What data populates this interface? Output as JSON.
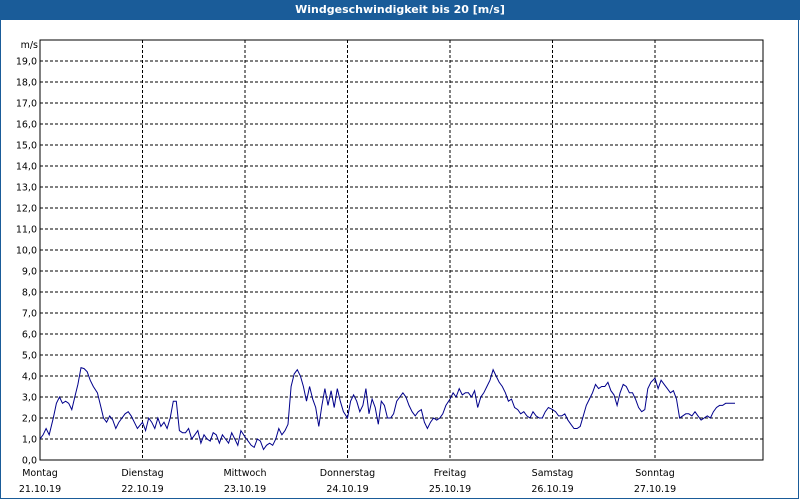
{
  "chart_data": {
    "type": "line",
    "title": "Windgeschwindigkeit bis 20 [m/s]",
    "ylabel": "m/s",
    "ylim": [
      0,
      20
    ],
    "yticks": [
      "0,0",
      "1,0",
      "2,0",
      "3,0",
      "4,0",
      "5,0",
      "6,0",
      "7,0",
      "8,0",
      "9,0",
      "10,0",
      "11,0",
      "12,0",
      "13,0",
      "14,0",
      "15,0",
      "16,0",
      "17,0",
      "18,0",
      "19,0"
    ],
    "x_categories": [
      {
        "day": "Montag",
        "date": "21.10.19"
      },
      {
        "day": "Dienstag",
        "date": "22.10.19"
      },
      {
        "day": "Mittwoch",
        "date": "23.10.19"
      },
      {
        "day": "Donnerstag",
        "date": "24.10.19"
      },
      {
        "day": "Freitag",
        "date": "25.10.19"
      },
      {
        "day": "Samstag",
        "date": "26.10.19"
      },
      {
        "day": "Sonntag",
        "date": "27.10.19"
      }
    ],
    "grid": true,
    "line_color": "#00008b",
    "series": [
      {
        "points": [
          [
            0.0,
            1.0
          ],
          [
            0.03,
            1.2
          ],
          [
            0.06,
            1.5
          ],
          [
            0.09,
            1.2
          ],
          [
            0.13,
            2.0
          ],
          [
            0.16,
            2.7
          ],
          [
            0.19,
            3.0
          ],
          [
            0.22,
            2.7
          ],
          [
            0.25,
            2.8
          ],
          [
            0.28,
            2.7
          ],
          [
            0.31,
            2.4
          ],
          [
            0.34,
            3.0
          ],
          [
            0.37,
            3.6
          ],
          [
            0.4,
            4.4
          ],
          [
            0.43,
            4.35
          ],
          [
            0.46,
            4.2
          ],
          [
            0.49,
            3.8
          ],
          [
            0.52,
            3.5
          ],
          [
            0.56,
            3.2
          ],
          [
            0.59,
            2.6
          ],
          [
            0.62,
            2.0
          ],
          [
            0.65,
            1.8
          ],
          [
            0.68,
            2.1
          ],
          [
            0.71,
            1.9
          ],
          [
            0.74,
            1.5
          ],
          [
            0.77,
            1.8
          ],
          [
            0.8,
            2.0
          ],
          [
            0.83,
            2.2
          ],
          [
            0.86,
            2.3
          ],
          [
            0.89,
            2.1
          ],
          [
            0.92,
            1.8
          ],
          [
            0.95,
            1.5
          ],
          [
            1.0,
            1.8
          ],
          [
            1.03,
            1.4
          ],
          [
            1.06,
            2.0
          ],
          [
            1.09,
            1.8
          ],
          [
            1.12,
            1.5
          ],
          [
            1.15,
            2.0
          ],
          [
            1.18,
            1.6
          ],
          [
            1.21,
            1.8
          ],
          [
            1.24,
            1.5
          ],
          [
            1.27,
            2.0
          ],
          [
            1.3,
            2.8
          ],
          [
            1.33,
            2.8
          ],
          [
            1.36,
            1.4
          ],
          [
            1.39,
            1.3
          ],
          [
            1.42,
            1.3
          ],
          [
            1.45,
            1.5
          ],
          [
            1.48,
            1.0
          ],
          [
            1.51,
            1.2
          ],
          [
            1.54,
            1.4
          ],
          [
            1.57,
            0.8
          ],
          [
            1.6,
            1.2
          ],
          [
            1.63,
            1.0
          ],
          [
            1.66,
            0.9
          ],
          [
            1.69,
            1.3
          ],
          [
            1.72,
            1.2
          ],
          [
            1.75,
            0.8
          ],
          [
            1.78,
            1.2
          ],
          [
            1.81,
            1.0
          ],
          [
            1.84,
            0.8
          ],
          [
            1.87,
            1.3
          ],
          [
            1.9,
            1.0
          ],
          [
            1.93,
            0.7
          ],
          [
            1.96,
            1.4
          ],
          [
            2.0,
            1.1
          ],
          [
            2.03,
            0.9
          ],
          [
            2.06,
            0.7
          ],
          [
            2.09,
            0.6
          ],
          [
            2.12,
            1.0
          ],
          [
            2.15,
            0.9
          ],
          [
            2.18,
            0.5
          ],
          [
            2.21,
            0.7
          ],
          [
            2.24,
            0.8
          ],
          [
            2.27,
            0.7
          ],
          [
            2.3,
            1.0
          ],
          [
            2.33,
            1.5
          ],
          [
            2.36,
            1.2
          ],
          [
            2.39,
            1.4
          ],
          [
            2.42,
            1.7
          ],
          [
            2.45,
            3.5
          ],
          [
            2.48,
            4.1
          ],
          [
            2.51,
            4.3
          ],
          [
            2.54,
            4.0
          ],
          [
            2.57,
            3.5
          ],
          [
            2.6,
            2.8
          ],
          [
            2.63,
            3.5
          ],
          [
            2.66,
            2.9
          ],
          [
            2.69,
            2.5
          ],
          [
            2.72,
            1.6
          ],
          [
            2.75,
            2.6
          ],
          [
            2.78,
            3.4
          ],
          [
            2.81,
            2.6
          ],
          [
            2.84,
            3.3
          ],
          [
            2.87,
            2.5
          ],
          [
            2.9,
            3.4
          ],
          [
            2.93,
            2.8
          ],
          [
            2.96,
            2.3
          ],
          [
            3.0,
            2.0
          ],
          [
            3.03,
            2.8
          ],
          [
            3.06,
            3.1
          ],
          [
            3.09,
            2.8
          ],
          [
            3.12,
            2.3
          ],
          [
            3.15,
            2.6
          ],
          [
            3.18,
            3.4
          ],
          [
            3.21,
            2.2
          ],
          [
            3.24,
            2.9
          ],
          [
            3.27,
            2.5
          ],
          [
            3.3,
            1.7
          ],
          [
            3.33,
            2.8
          ],
          [
            3.36,
            2.6
          ],
          [
            3.39,
            2.0
          ],
          [
            3.42,
            2.0
          ],
          [
            3.45,
            2.2
          ],
          [
            3.48,
            2.8
          ],
          [
            3.51,
            3.0
          ],
          [
            3.54,
            3.2
          ],
          [
            3.57,
            3.0
          ],
          [
            3.6,
            2.6
          ],
          [
            3.63,
            2.3
          ],
          [
            3.66,
            2.1
          ],
          [
            3.69,
            2.3
          ],
          [
            3.72,
            2.4
          ],
          [
            3.75,
            1.8
          ],
          [
            3.78,
            1.5
          ],
          [
            3.81,
            1.8
          ],
          [
            3.84,
            2.0
          ],
          [
            3.87,
            1.9
          ],
          [
            3.9,
            2.0
          ],
          [
            3.93,
            2.2
          ],
          [
            3.96,
            2.6
          ],
          [
            4.0,
            2.9
          ],
          [
            4.03,
            3.2
          ],
          [
            4.06,
            3.0
          ],
          [
            4.09,
            3.4
          ],
          [
            4.12,
            3.1
          ],
          [
            4.15,
            3.2
          ],
          [
            4.18,
            3.2
          ],
          [
            4.21,
            3.0
          ],
          [
            4.24,
            3.3
          ],
          [
            4.27,
            2.5
          ],
          [
            4.3,
            3.0
          ],
          [
            4.33,
            3.2
          ],
          [
            4.36,
            3.5
          ],
          [
            4.39,
            3.8
          ],
          [
            4.42,
            4.3
          ],
          [
            4.45,
            4.0
          ],
          [
            4.48,
            3.7
          ],
          [
            4.51,
            3.5
          ],
          [
            4.54,
            3.2
          ],
          [
            4.57,
            2.8
          ],
          [
            4.6,
            2.9
          ],
          [
            4.63,
            2.5
          ],
          [
            4.66,
            2.4
          ],
          [
            4.69,
            2.2
          ],
          [
            4.72,
            2.3
          ],
          [
            4.75,
            2.1
          ],
          [
            4.78,
            2.0
          ],
          [
            4.81,
            2.3
          ],
          [
            4.84,
            2.1
          ],
          [
            4.87,
            2.0
          ],
          [
            4.9,
            2.0
          ],
          [
            4.93,
            2.3
          ],
          [
            4.96,
            2.5
          ],
          [
            5.0,
            2.4
          ],
          [
            5.03,
            2.3
          ],
          [
            5.06,
            2.1
          ],
          [
            5.09,
            2.1
          ],
          [
            5.12,
            2.2
          ],
          [
            5.15,
            1.9
          ],
          [
            5.18,
            1.7
          ],
          [
            5.21,
            1.5
          ],
          [
            5.24,
            1.5
          ],
          [
            5.27,
            1.6
          ],
          [
            5.3,
            2.1
          ],
          [
            5.33,
            2.6
          ],
          [
            5.36,
            2.9
          ],
          [
            5.39,
            3.2
          ],
          [
            5.42,
            3.6
          ],
          [
            5.45,
            3.4
          ],
          [
            5.48,
            3.5
          ],
          [
            5.51,
            3.5
          ],
          [
            5.54,
            3.7
          ],
          [
            5.57,
            3.3
          ],
          [
            5.6,
            3.1
          ],
          [
            5.63,
            2.6
          ],
          [
            5.66,
            3.2
          ],
          [
            5.69,
            3.6
          ],
          [
            5.72,
            3.5
          ],
          [
            5.75,
            3.2
          ],
          [
            5.78,
            3.2
          ],
          [
            5.81,
            2.9
          ],
          [
            5.84,
            2.5
          ],
          [
            5.87,
            2.3
          ],
          [
            5.9,
            2.4
          ],
          [
            5.93,
            3.4
          ],
          [
            5.96,
            3.7
          ],
          [
            6.0,
            3.9
          ],
          [
            6.03,
            3.4
          ],
          [
            6.06,
            3.8
          ],
          [
            6.09,
            3.6
          ],
          [
            6.12,
            3.4
          ],
          [
            6.15,
            3.2
          ],
          [
            6.18,
            3.3
          ],
          [
            6.21,
            2.9
          ],
          [
            6.24,
            2.0
          ],
          [
            6.27,
            2.1
          ],
          [
            6.3,
            2.2
          ],
          [
            6.33,
            2.2
          ],
          [
            6.36,
            2.1
          ],
          [
            6.39,
            2.3
          ],
          [
            6.42,
            2.1
          ],
          [
            6.45,
            1.9
          ],
          [
            6.48,
            2.0
          ],
          [
            6.51,
            2.1
          ],
          [
            6.54,
            2.0
          ],
          [
            6.57,
            2.3
          ],
          [
            6.6,
            2.5
          ],
          [
            6.63,
            2.6
          ],
          [
            6.66,
            2.6
          ],
          [
            6.69,
            2.7
          ],
          [
            6.72,
            2.7
          ],
          [
            6.75,
            2.7
          ],
          [
            6.78,
            2.7
          ]
        ]
      }
    ]
  }
}
